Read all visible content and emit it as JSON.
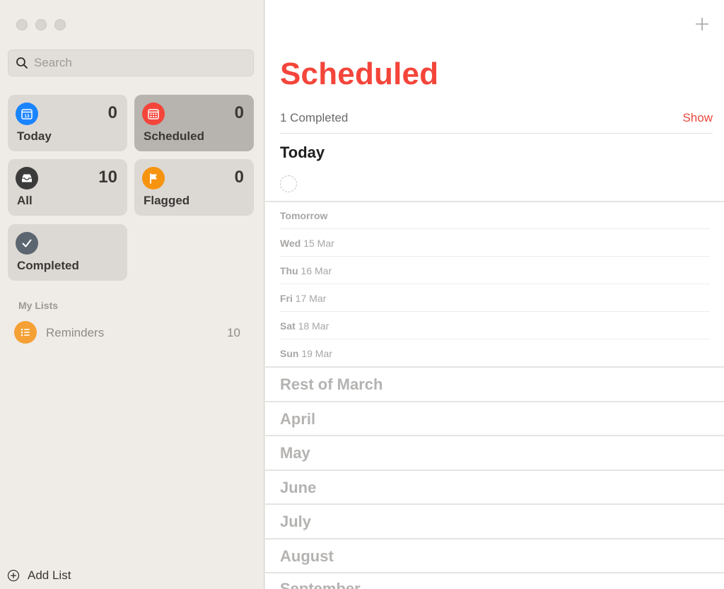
{
  "sidebar": {
    "search": {
      "placeholder": "Search",
      "value": ""
    },
    "tiles": [
      {
        "label": "Today",
        "count": "0",
        "icon": "calendar-today-icon",
        "icon_text": "13",
        "color": "#1a84ff"
      },
      {
        "label": "Scheduled",
        "count": "0",
        "icon": "calendar-scheduled-icon",
        "color": "#f4453a",
        "selected": true
      },
      {
        "label": "All",
        "count": "10",
        "icon": "tray-icon",
        "color": "#3b3b3b"
      },
      {
        "label": "Flagged",
        "count": "0",
        "icon": "flag-icon",
        "color": "#f7940f"
      },
      {
        "label": "Completed",
        "count": "",
        "icon": "checkmark-icon",
        "color": "#5c6670"
      }
    ],
    "my_lists_header": "My Lists",
    "lists": [
      {
        "name": "Reminders",
        "count": "10",
        "icon": "list-bullet-icon",
        "color": "#f5a035"
      }
    ],
    "add_list_label": "Add List"
  },
  "main": {
    "title": "Scheduled",
    "completed_text": "1 Completed",
    "show_label": "Show",
    "today_header": "Today",
    "days": [
      {
        "day": "Tomorrow",
        "date": ""
      },
      {
        "day": "Wed",
        "date": "15 Mar"
      },
      {
        "day": "Thu",
        "date": "16 Mar"
      },
      {
        "day": "Fri",
        "date": "17 Mar"
      },
      {
        "day": "Sat",
        "date": "18 Mar"
      },
      {
        "day": "Sun",
        "date": "19 Mar"
      }
    ],
    "months": [
      "Rest of March",
      "April",
      "May",
      "June",
      "July",
      "August",
      "September"
    ]
  },
  "colors": {
    "accent": "#f4453a",
    "sidebar_bg": "#efebe7",
    "selected_tile": "#b7b3af"
  }
}
